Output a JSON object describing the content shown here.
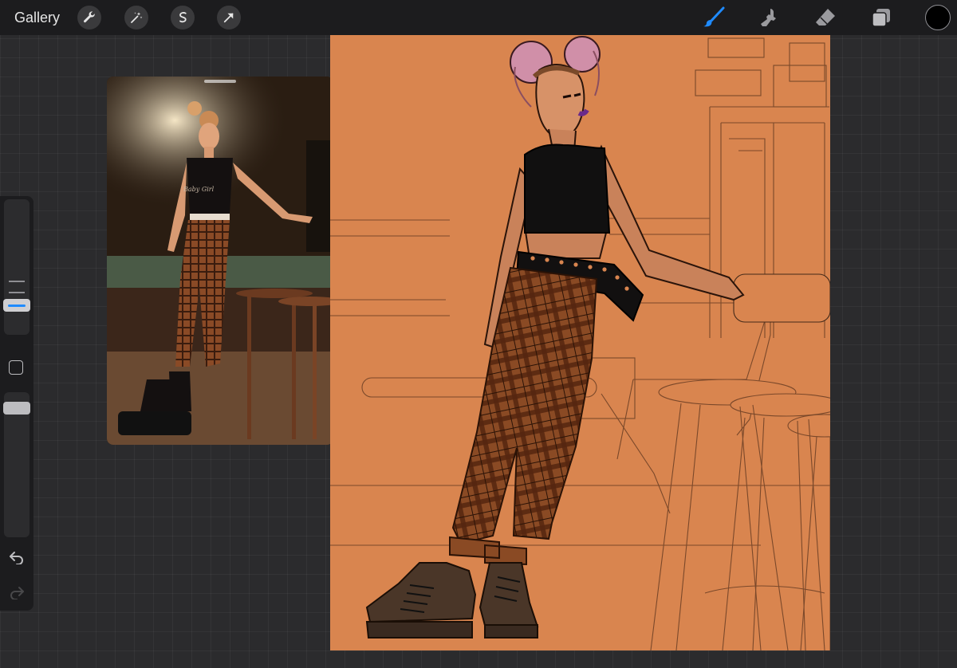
{
  "app": {
    "gallery_label": "Gallery"
  },
  "toolbar": {
    "left_tools": [
      "wrench-icon",
      "magic-wand-icon",
      "selection-icon",
      "transform-arrow-icon"
    ],
    "right_tools": [
      "brush-icon",
      "smudge-icon",
      "eraser-icon",
      "layers-icon"
    ],
    "active_tool": "brush-icon",
    "active_color": "#000000",
    "accent": "#1f8bff"
  },
  "sidebar": {
    "brush_size": 0.8,
    "opacity": 1.0
  },
  "reference": {
    "tank_top_text": "Baby Girl"
  },
  "canvas": {
    "background": "#d9854f"
  }
}
